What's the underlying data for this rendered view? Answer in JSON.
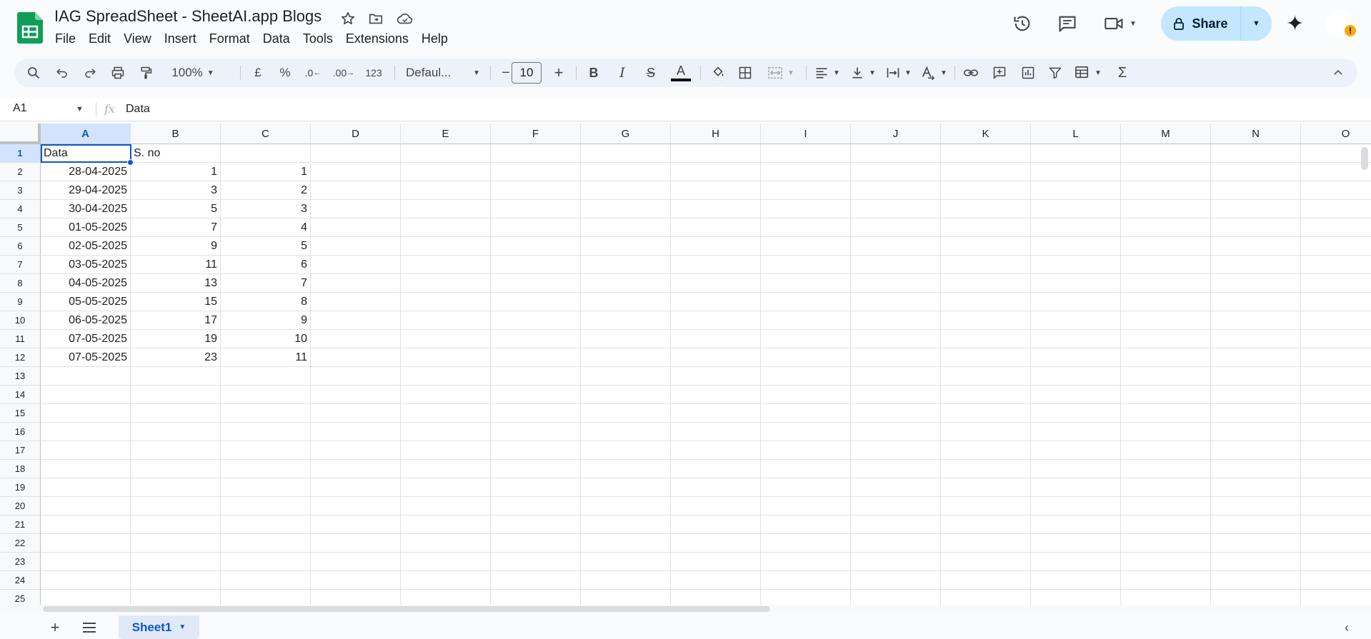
{
  "header": {
    "title": "IAG SpreadSheet - SheetAI.app Blogs",
    "menu": [
      "File",
      "Edit",
      "View",
      "Insert",
      "Format",
      "Data",
      "Tools",
      "Extensions",
      "Help"
    ],
    "share_label": "Share",
    "icons": [
      "star-icon",
      "move-to-folder-icon",
      "cloud-saved-icon",
      "version-history-icon",
      "comments-icon",
      "meet-video-icon",
      "gemini-icon"
    ]
  },
  "toolbar": {
    "zoom": "100%",
    "currency": "£",
    "percent": "%",
    "decrease_decimal": ".0",
    "increase_decimal": ".00",
    "more_formats": "123",
    "font": "Defaul...",
    "font_size": "10",
    "minus": "−",
    "plus": "+",
    "bold": "B",
    "italic": "I",
    "strike": "S",
    "text_color": "A",
    "sum": "Σ"
  },
  "formula_bar": {
    "cell_ref": "A1",
    "fx": "fx",
    "content": "Data"
  },
  "grid": {
    "columns": [
      "A",
      "B",
      "C",
      "D",
      "E",
      "F",
      "G",
      "H",
      "I",
      "J",
      "K",
      "L",
      "M",
      "N",
      "O"
    ],
    "row_numbers": [
      "1",
      "2",
      "3",
      "4",
      "5",
      "6",
      "7",
      "8",
      "9",
      "10",
      "11",
      "12",
      "13",
      "14",
      "15",
      "16",
      "17",
      "18",
      "19",
      "20",
      "21",
      "22",
      "23",
      "24",
      "25"
    ],
    "rows": [
      [
        "Data",
        "S. no",
        ""
      ],
      [
        "28-04-2025",
        "1",
        "1"
      ],
      [
        "29-04-2025",
        "3",
        "2"
      ],
      [
        "30-04-2025",
        "5",
        "3"
      ],
      [
        "01-05-2025",
        "7",
        "4"
      ],
      [
        "02-05-2025",
        "9",
        "5"
      ],
      [
        "03-05-2025",
        "11",
        "6"
      ],
      [
        "04-05-2025",
        "13",
        "7"
      ],
      [
        "05-05-2025",
        "15",
        "8"
      ],
      [
        "06-05-2025",
        "17",
        "9"
      ],
      [
        "07-05-2025",
        "19",
        "10"
      ],
      [
        "07-05-2025",
        "23",
        "11"
      ]
    ],
    "selected_cell": "A1"
  },
  "sheets": {
    "active": "Sheet1"
  },
  "colors": {
    "accent": "#0b57d0",
    "share_bg": "#c2e7ff",
    "toolbar_bg": "#edf2fa",
    "logo_green": "#0f9d58"
  }
}
